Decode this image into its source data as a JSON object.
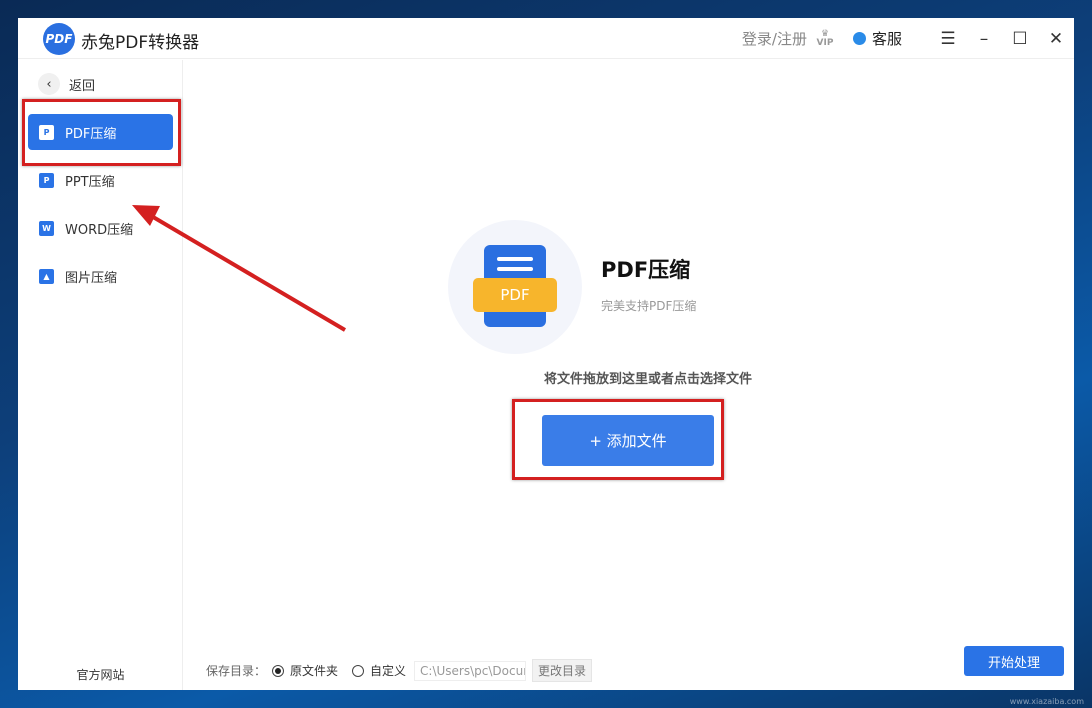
{
  "app": {
    "logo": "PDF",
    "title": "赤兔PDF转换器",
    "login": "登录/注册",
    "vip": "VIP",
    "service": "客服",
    "menu": "☰",
    "minimize": "–",
    "maximize": "☐",
    "close": "✕"
  },
  "sidebar": {
    "back": "返回",
    "items": [
      {
        "label": "PDF压缩",
        "icon": "P"
      },
      {
        "label": "PPT压缩",
        "icon": "P"
      },
      {
        "label": "WORD压缩",
        "icon": "W"
      },
      {
        "label": "图片压缩",
        "icon": "▲"
      }
    ],
    "website": "官方网站"
  },
  "main": {
    "doc_tag": "PDF",
    "title": "PDF压缩",
    "subtitle": "完美支持PDF压缩",
    "hint": "将文件拖放到这里或者点击选择文件",
    "add_button": "+   添加文件"
  },
  "footer": {
    "save_label": "保存目录：",
    "option_original": "原文件夹",
    "option_custom": "自定义",
    "path": "C:\\Users\\pc\\Documents\\ctPdfConverter",
    "change_dir": "更改目录",
    "start": "开始处理"
  },
  "watermark": "www.xiazaiba.com"
}
